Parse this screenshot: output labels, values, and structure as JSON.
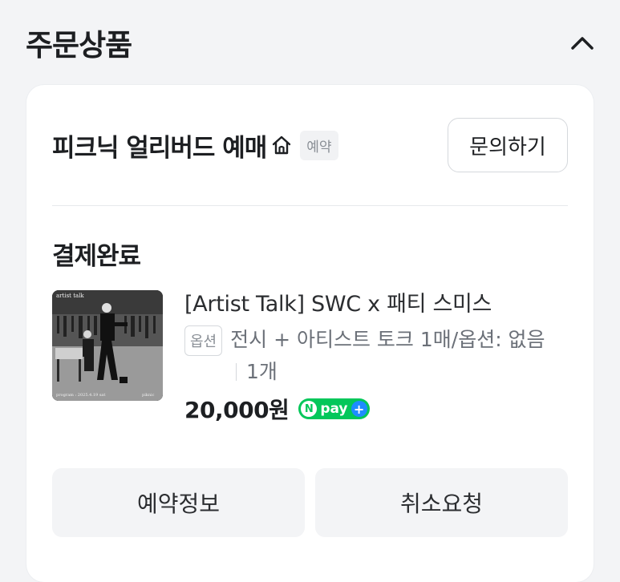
{
  "section": {
    "title": "주문상품"
  },
  "store": {
    "name": "피크닉 얼리버드 예매",
    "badge": "예약",
    "inquiry_button": "문의하기"
  },
  "order": {
    "status": "결제완료",
    "thumbnail": {
      "top_text": "artist talk",
      "bottom_left_text": "program : 2025.4.19 sat",
      "bottom_right_text": "piknic"
    },
    "product_title": "[Artist Talk] SWC x 패티 스미스",
    "option_badge": "옵션",
    "option_text": "전시 + 아티스트 토크 1매/옵션: 없음",
    "quantity": "1개",
    "price": "20,000원",
    "payment": {
      "n": "N",
      "label": "pay",
      "plus": "+"
    }
  },
  "actions": {
    "reservation_info": "예약정보",
    "cancel_request": "취소요청"
  },
  "colors": {
    "npay_green": "#03c75a",
    "npay_blue": "#1e8cff",
    "background": "#f3f4f6"
  }
}
